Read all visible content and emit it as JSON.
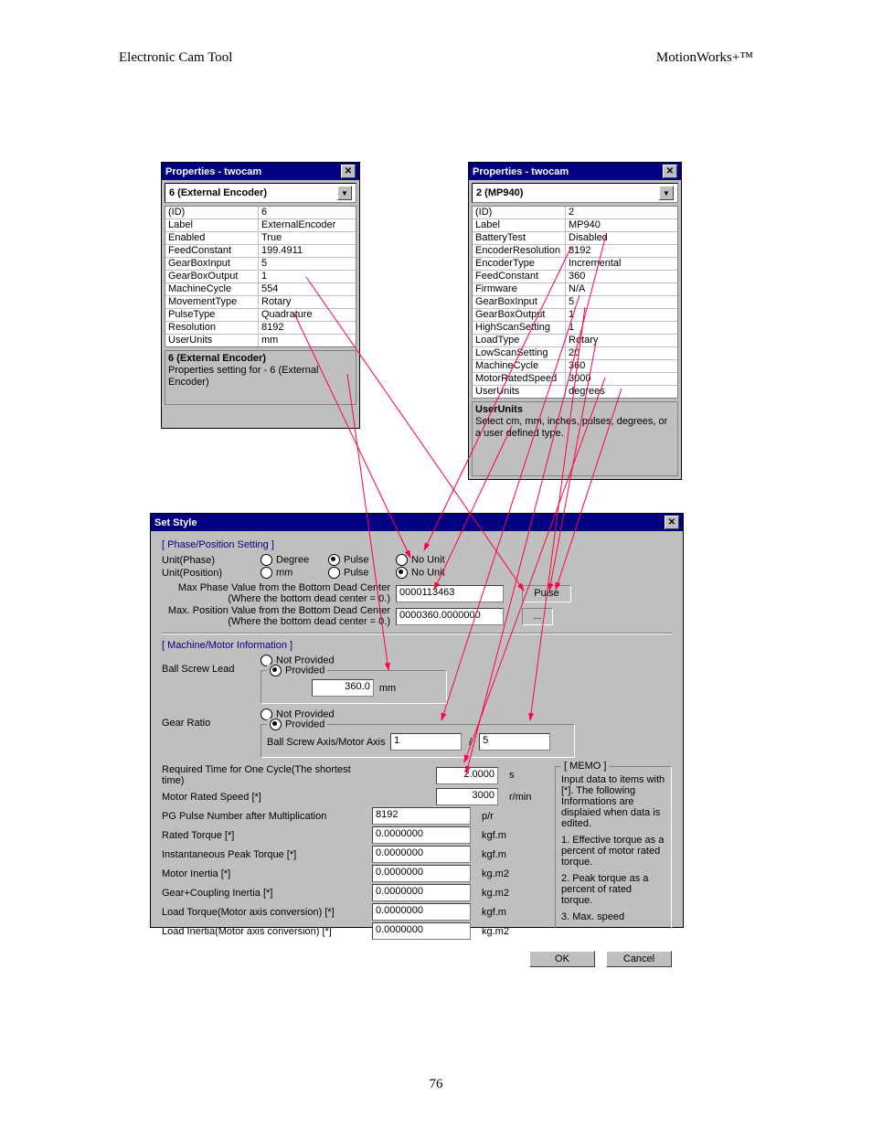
{
  "page": {
    "header_left": "Electronic Cam Tool",
    "header_right": "MotionWorks+™",
    "number": "76"
  },
  "prop1": {
    "title": "Properties - twocam",
    "select": "6 (External Encoder)",
    "rows": [
      {
        "k": "(ID)",
        "v": "6"
      },
      {
        "k": "Label",
        "v": "ExternalEncoder"
      },
      {
        "k": "Enabled",
        "v": "True"
      },
      {
        "k": "FeedConstant",
        "v": "199.4911"
      },
      {
        "k": "GearBoxInput",
        "v": "5"
      },
      {
        "k": "GearBoxOutput",
        "v": "1"
      },
      {
        "k": "MachineCycle",
        "v": "554"
      },
      {
        "k": "MovementType",
        "v": "Rotary"
      },
      {
        "k": "PulseType",
        "v": "Quadrature"
      },
      {
        "k": "Resolution",
        "v": "8192"
      },
      {
        "k": "UserUnits",
        "v": "mm"
      }
    ],
    "help_title": "6 (External Encoder)",
    "help_text": "Properties setting for - 6 (External Encoder)"
  },
  "prop2": {
    "title": "Properties - twocam",
    "select": "2 (MP940)",
    "rows": [
      {
        "k": "(ID)",
        "v": "2"
      },
      {
        "k": "Label",
        "v": "MP940"
      },
      {
        "k": "BatteryTest",
        "v": "Disabled"
      },
      {
        "k": "EncoderResolution",
        "v": "8192"
      },
      {
        "k": "EncoderType",
        "v": "Incremental"
      },
      {
        "k": "FeedConstant",
        "v": "360"
      },
      {
        "k": "Firmware",
        "v": "N/A"
      },
      {
        "k": "GearBoxInput",
        "v": "5"
      },
      {
        "k": "GearBoxOutput",
        "v": "1"
      },
      {
        "k": "HighScanSetting",
        "v": "1"
      },
      {
        "k": "LoadType",
        "v": "Rotary"
      },
      {
        "k": "LowScanSetting",
        "v": "20"
      },
      {
        "k": "MachineCycle",
        "v": "360"
      },
      {
        "k": "MotorRatedSpeed",
        "v": "3000"
      },
      {
        "k": "UserUnits",
        "v": "degrees"
      }
    ],
    "help_title": "UserUnits",
    "help_text": "Select cm, mm, inches, pulses, degrees, or a user defined type."
  },
  "ss": {
    "title": "Set Style",
    "sec_phase": "[ Phase/Position Setting ]",
    "unit_phase_lbl": "Unit(Phase)",
    "unit_pos_lbl": "Unit(Position)",
    "r_degree": "Degree",
    "r_pulse": "Pulse",
    "r_nounit": "No Unit",
    "r_mm": "mm",
    "max_phase_lbl": "Max Phase Value from the Bottom Dead Center",
    "max_pos_lbl": "Max. Position Value from the Bottom Dead Center",
    "where": "(Where the bottom dead center = 0.)",
    "max_phase_val": "0000113463",
    "max_phase_unit": "Pulse",
    "max_pos_val": "0000360.0000000",
    "max_pos_unit": "...",
    "sec_machine": "[ Machine/Motor Information ]",
    "ball_screw_lbl": "Ball Screw Lead",
    "not_provided": "Not Provided",
    "provided": "Provided",
    "ball_screw_val": "360.0",
    "ball_screw_unit": "mm",
    "gear_ratio_lbl": "Gear Ratio",
    "gear_ratio_sub": "Ball Screw Axis/Motor Axis",
    "gear_a": "1",
    "gear_sep": "/",
    "gear_b": "5",
    "rows": [
      {
        "l": "Required Time for One Cycle(The shortest time)",
        "v": "2.0000",
        "u": "s"
      },
      {
        "l": "Motor Rated Speed [*]",
        "v": "3000",
        "u": "r/min"
      },
      {
        "l": "PG Pulse Number after Multiplication",
        "v": "8192",
        "u": "p/r"
      },
      {
        "l": "Rated Torque [*]",
        "v": "0.0000000",
        "u": "kgf.m"
      },
      {
        "l": "Instantaneous Peak Torque [*]",
        "v": "0.0000000",
        "u": "kgf.m"
      },
      {
        "l": "Motor Inertia [*]",
        "v": "0.0000000",
        "u": "kg.m2"
      },
      {
        "l": "Gear+Coupling Inertia [*]",
        "v": "0.0000000",
        "u": "kg.m2"
      },
      {
        "l": "Load Torque(Motor axis conversion) [*]",
        "v": "0.0000000",
        "u": "kgf.m"
      },
      {
        "l": "Load Inertia(Motor axis conversion) [*]",
        "v": "0.0000000",
        "u": "kg.m2"
      }
    ],
    "memo_title": "[ MEMO ]",
    "memo1": "Input data to items with [*]. The following Informations are displaied when data is edited.",
    "memo2": "1. Effective torque as a percent of motor rated torque.",
    "memo3": "2. Peak torque as a percent of rated torque.",
    "memo4": "3. Max. speed",
    "ok": "OK",
    "cancel": "Cancel"
  }
}
